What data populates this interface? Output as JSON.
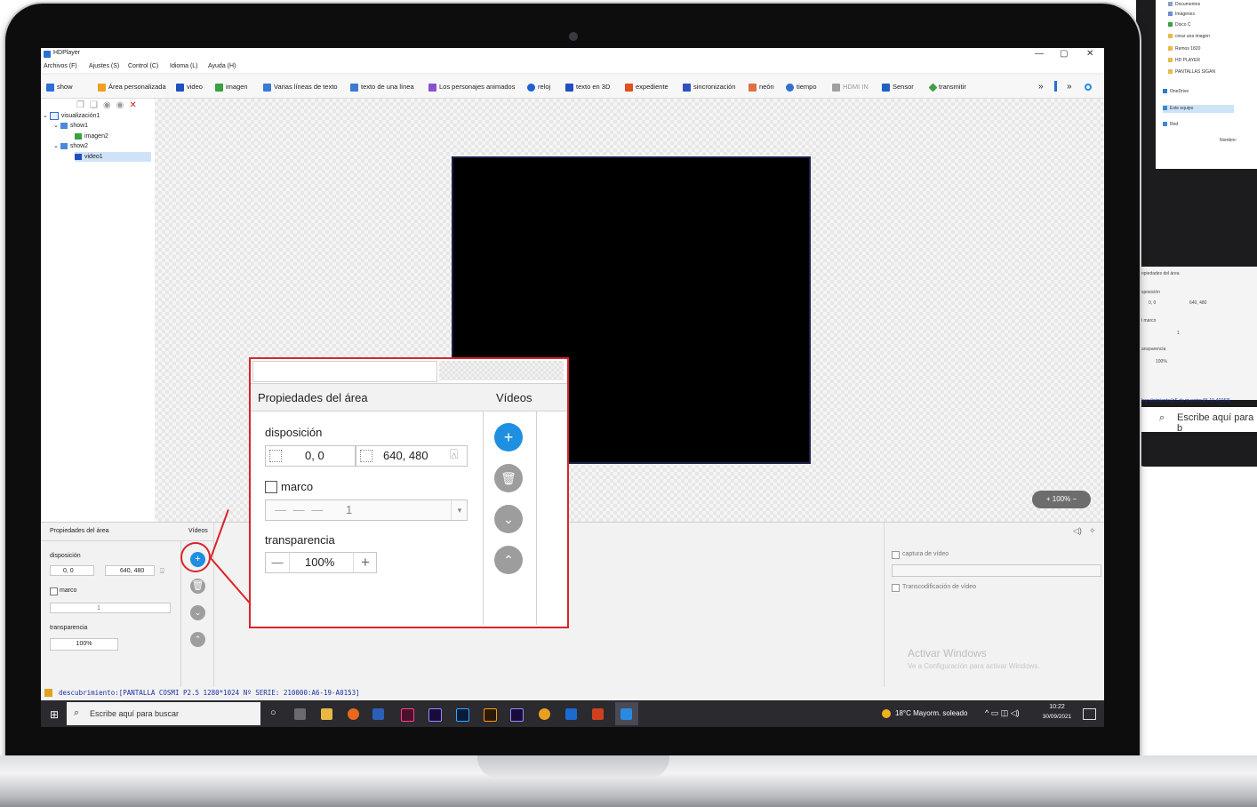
{
  "background_window": {
    "explorer_items": [
      "Documentos",
      "Imágenes",
      "Disco C",
      "crear una imagen",
      "Remos 1820",
      "HD PLAYER",
      "PANTALLAS SIGAN"
    ],
    "onedrive": "OneDrive",
    "this_pc": "Este equipo",
    "network": "Red",
    "name_label": "Nombre:",
    "props_title": "opiedades del área",
    "disposicion": "sposición",
    "pos": "0, 0",
    "size": "640, 480",
    "marco": "l marco",
    "marco_val": "1",
    "transparencia": "ansparencia",
    "transp_val": "100%",
    "status": "descubrimiento:[pS de muestro:A5-19-A0153]",
    "search": "Escribe aquí para b"
  },
  "app": {
    "title": "HDPlayer",
    "window_controls": [
      "—",
      "▢",
      "✕"
    ],
    "menu": [
      "Archivos (F)",
      "Ajustes (S)",
      "Control (C)",
      "Idioma (L)",
      "Ayuda (H)"
    ],
    "toolbar": [
      {
        "label": "show",
        "color": "#2b6fd6"
      },
      {
        "label": "Área personalizada",
        "color": "#f0a020"
      },
      {
        "label": "video",
        "color": "#2050c0"
      },
      {
        "label": "imagen",
        "color": "#3aa040"
      },
      {
        "label": "Varias líneas de texto",
        "color": "#3a7ad0"
      },
      {
        "label": "texto de una línea",
        "color": "#3a7ad0"
      },
      {
        "label": "Los personajes animados",
        "color": "#8a50d0"
      },
      {
        "label": "reloj",
        "color": "#2060d0"
      },
      {
        "label": "texto en 3D",
        "color": "#2050c0"
      },
      {
        "label": "expediente",
        "color": "#e05020"
      },
      {
        "label": "sincronización",
        "color": "#3050c0"
      },
      {
        "label": "neón",
        "color": "#e07040"
      },
      {
        "label": "tiempo",
        "color": "#3070d0"
      },
      {
        "label": "HDMI IN",
        "color": "#a0a0a0"
      },
      {
        "label": "Sensor",
        "color": "#2060c0"
      },
      {
        "label": "transmitir",
        "color": "#40a040"
      }
    ],
    "toolbar_more": "»",
    "tree": {
      "root": "visualización1",
      "show1": "show1",
      "imagen2": "imagen2",
      "show2": "show2",
      "video1": "video1"
    },
    "zoom": "+ 100% −",
    "bottom": {
      "props_title": "Propiedades del área",
      "videos_title": "Vídeos",
      "disposicion": "disposición",
      "pos": "0, 0",
      "size": "640, 480",
      "marco": "marco",
      "marco_val": "1",
      "transparencia": "transparencia",
      "transp_val": "100%",
      "captura": "captura de vídeo",
      "transcod": "Transcodificación de vídeo",
      "activate_title": "Activar Windows",
      "activate_sub": "Ve a Configuración para activar Windows."
    },
    "status": "descubrimiento:[PANTALLA COSMI P2.5 1280*1024 Nº SERIE: 210000:A6-19-A0153]",
    "taskbar": {
      "search_placeholder": "Escribe aquí para buscar",
      "weather": "18°C  Mayorm. soleado",
      "time": "10:22",
      "date": "30/09/2021"
    }
  },
  "callout": {
    "props_title": "Propiedades del área",
    "videos_title": "Vídeos",
    "disposicion": "disposición",
    "pos": "0, 0",
    "size": "640, 480",
    "marco": "marco",
    "marco_val": "1",
    "transparencia": "transparencia",
    "transp_val": "100%",
    "minus": "—",
    "plus": "+"
  }
}
